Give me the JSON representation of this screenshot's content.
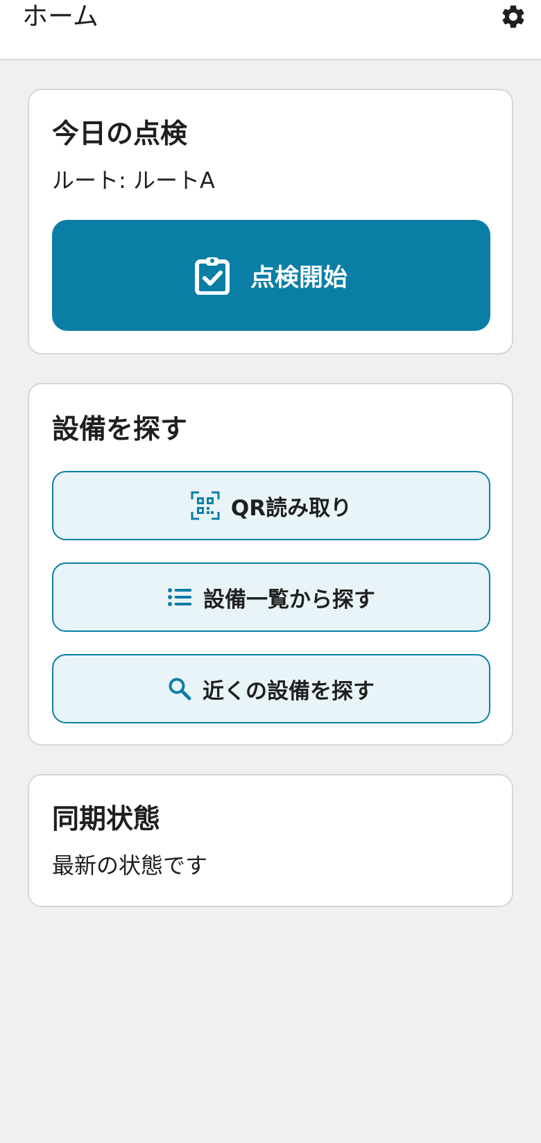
{
  "header": {
    "title": "ホーム",
    "settings_icon": "gear-icon"
  },
  "today_card": {
    "title": "今日の点検",
    "route_text": "ルート: ルートA",
    "start_button_label": "点検開始",
    "start_button_icon": "clipboard-check-icon"
  },
  "find_card": {
    "title": "設備を探す",
    "buttons": [
      {
        "label": "QR読み取り",
        "icon": "qr-code-icon"
      },
      {
        "label": "設備一覧から探す",
        "icon": "list-icon"
      },
      {
        "label": "近くの設備を探す",
        "icon": "search-icon"
      }
    ]
  },
  "sync_card": {
    "title": "同期状態",
    "status_text": "最新の状態です"
  },
  "colors": {
    "primary": "#0b7ea6",
    "outline_button_bg": "#e9f4f8",
    "background": "#f0f0f0",
    "card_border": "#d6d6d6"
  }
}
